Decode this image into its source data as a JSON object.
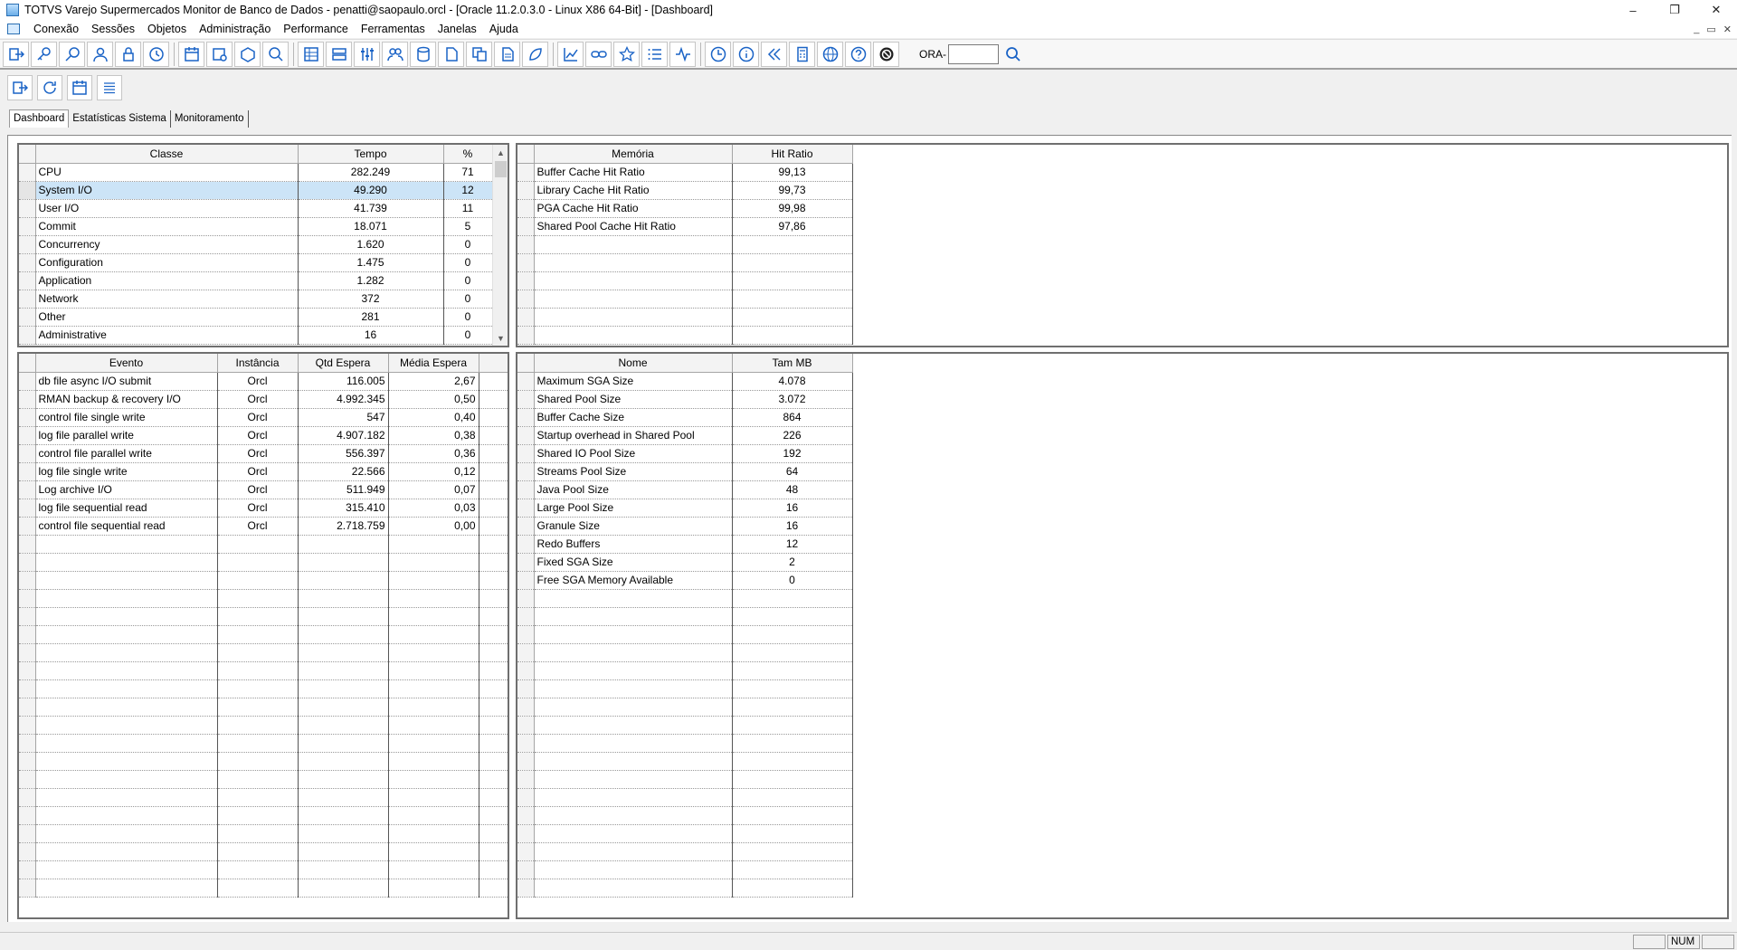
{
  "window": {
    "title": "TOTVS Varejo Supermercados Monitor de Banco de Dados - penatti@saopaulo.orcl - [Oracle 11.2.0.3.0 - Linux X86 64-Bit] - [Dashboard]",
    "minimize": "–",
    "restore": "❐",
    "close": "✕"
  },
  "menu": {
    "items": [
      {
        "label": "Conexão"
      },
      {
        "label": "Sessões"
      },
      {
        "label": "Objetos"
      },
      {
        "label": "Administração"
      },
      {
        "label": "Performance"
      },
      {
        "label": "Ferramentas"
      },
      {
        "label": "Janelas"
      },
      {
        "label": "Ajuda"
      }
    ],
    "mdi_minimize": "_",
    "mdi_restore": "▭",
    "mdi_close": "✕"
  },
  "toolbar": {
    "ora_label": "ORA-",
    "ora_value": ""
  },
  "tabs": [
    {
      "label": "Dashboard",
      "active": true
    },
    {
      "label": "Estatísticas Sistema",
      "active": false
    },
    {
      "label": "Monitoramento",
      "active": false
    }
  ],
  "classes_grid": {
    "headers": [
      "Classe",
      "Tempo",
      "%"
    ],
    "rows": [
      [
        "CPU",
        "282.249",
        "71"
      ],
      [
        "System I/O",
        "49.290",
        "12"
      ],
      [
        "User I/O",
        "41.739",
        "11"
      ],
      [
        "Commit",
        "18.071",
        "5"
      ],
      [
        "Concurrency",
        "1.620",
        "0"
      ],
      [
        "Configuration",
        "1.475",
        "0"
      ],
      [
        "Application",
        "1.282",
        "0"
      ],
      [
        "Network",
        "372",
        "0"
      ],
      [
        "Other",
        "281",
        "0"
      ],
      [
        "Administrative",
        "16",
        "0"
      ]
    ],
    "selected_row": 1
  },
  "memory_grid": {
    "headers": [
      "Memória",
      "Hit Ratio"
    ],
    "rows": [
      [
        "Buffer Cache Hit Ratio",
        "99,13"
      ],
      [
        "Library Cache Hit Ratio",
        "99,73"
      ],
      [
        "PGA Cache Hit Ratio",
        "99,98"
      ],
      [
        "Shared Pool Cache Hit Ratio",
        "97,86"
      ]
    ]
  },
  "events_grid": {
    "headers": [
      "Evento",
      "Instância",
      "Qtd Espera",
      "Média Espera"
    ],
    "rows": [
      [
        "db file async I/O submit",
        "Orcl",
        "116.005",
        "2,67"
      ],
      [
        "RMAN backup & recovery I/O",
        "Orcl",
        "4.992.345",
        "0,50"
      ],
      [
        "control file single write",
        "Orcl",
        "547",
        "0,40"
      ],
      [
        "log file parallel write",
        "Orcl",
        "4.907.182",
        "0,38"
      ],
      [
        "control file parallel write",
        "Orcl",
        "556.397",
        "0,36"
      ],
      [
        "log file single write",
        "Orcl",
        "22.566",
        "0,12"
      ],
      [
        "Log archive I/O",
        "Orcl",
        "511.949",
        "0,07"
      ],
      [
        "log file sequential read",
        "Orcl",
        "315.410",
        "0,03"
      ],
      [
        "control file sequential read",
        "Orcl",
        "2.718.759",
        "0,00"
      ]
    ]
  },
  "sga_grid": {
    "headers": [
      "Nome",
      "Tam MB"
    ],
    "rows": [
      [
        "Maximum SGA Size",
        "4.078"
      ],
      [
        "Shared Pool Size",
        "3.072"
      ],
      [
        "Buffer Cache Size",
        "864"
      ],
      [
        "Startup overhead in Shared Pool",
        "226"
      ],
      [
        "Shared IO Pool Size",
        "192"
      ],
      [
        "Streams Pool Size",
        "64"
      ],
      [
        "Java Pool Size",
        "48"
      ],
      [
        "Large Pool Size",
        "16"
      ],
      [
        "Granule Size",
        "16"
      ],
      [
        "Redo Buffers",
        "12"
      ],
      [
        "Fixed SGA Size",
        "2"
      ],
      [
        "Free SGA Memory Available",
        "0"
      ]
    ]
  },
  "statusbar": {
    "num": "NUM"
  }
}
